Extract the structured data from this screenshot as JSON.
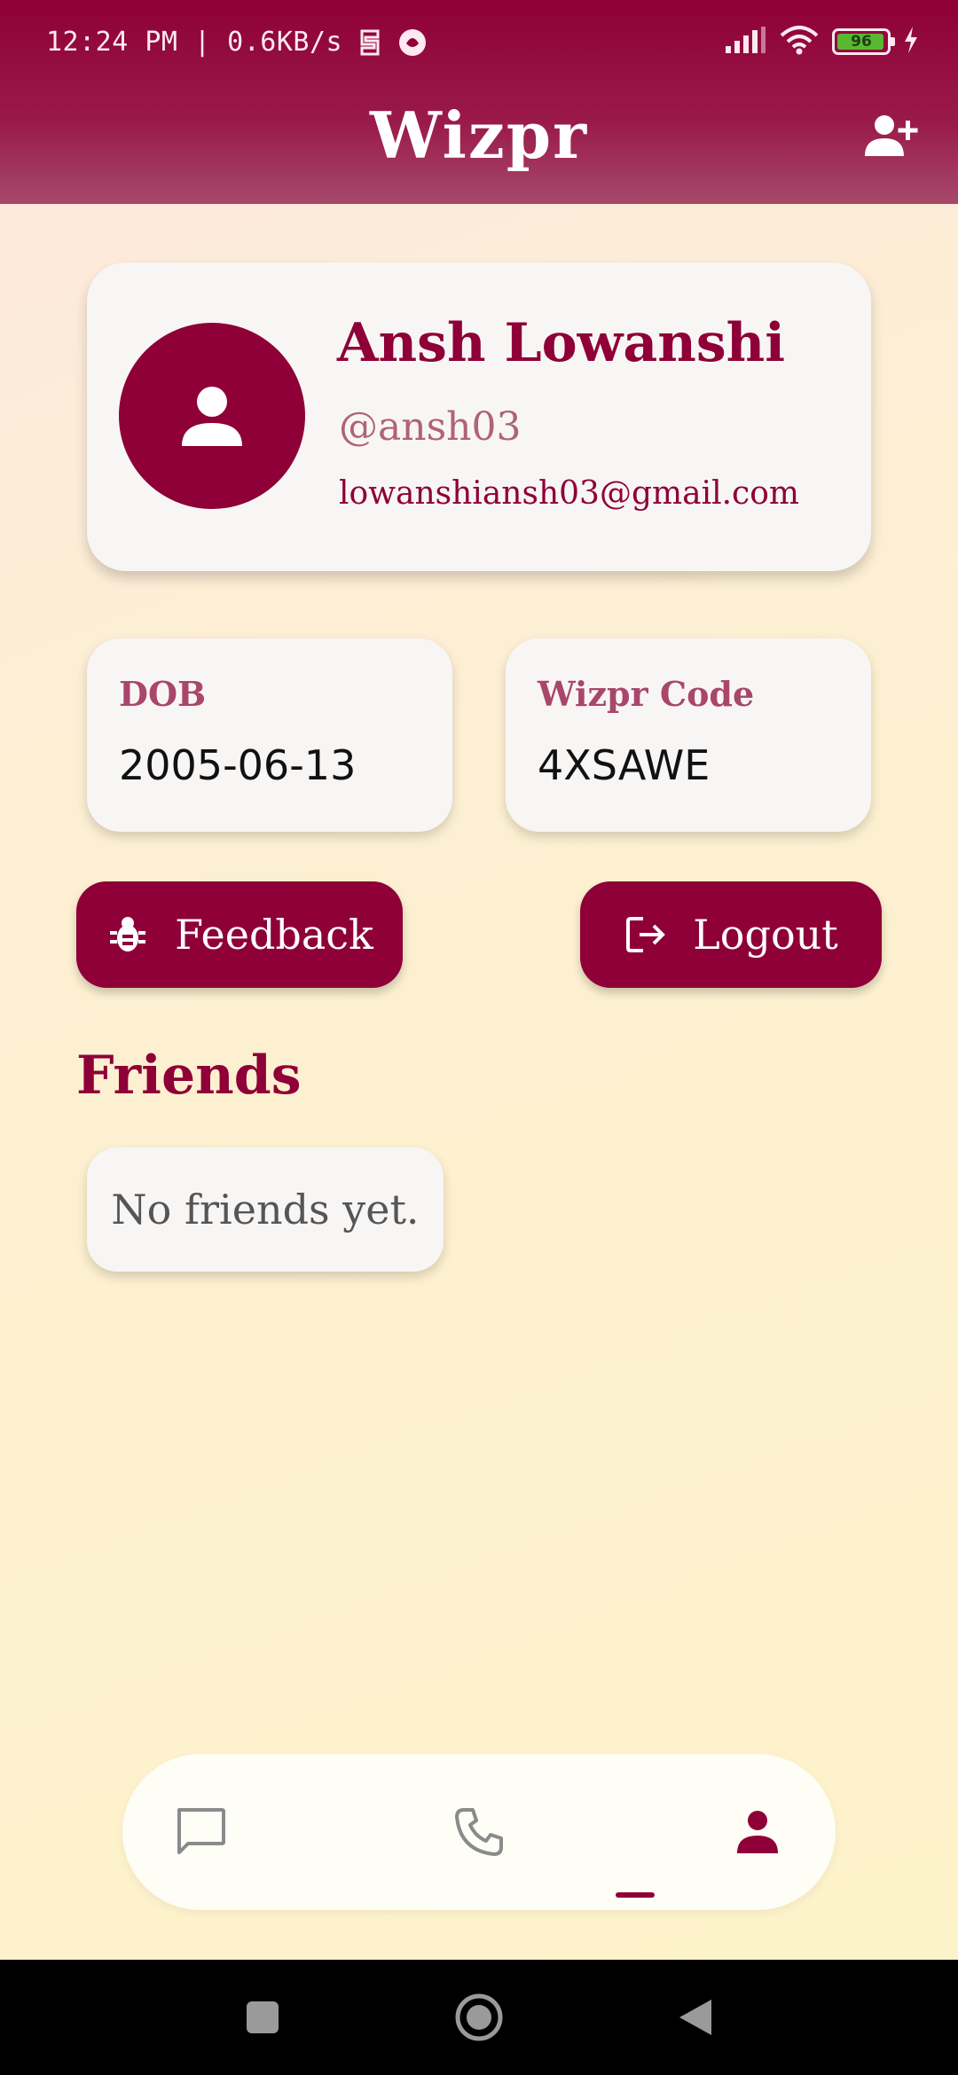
{
  "status_bar": {
    "time_and_speed": "12:24 PM | 0.6KB/s",
    "battery_percent": "96",
    "battery_level": 0.96
  },
  "header": {
    "title": "Wizpr",
    "add_friend_icon": "person-add-icon"
  },
  "profile": {
    "name": "Ansh Lowanshi",
    "handle": "@ansh03",
    "email": "lowanshiansh03@gmail.com",
    "avatar_icon": "person-icon"
  },
  "info": {
    "dob_label": "DOB",
    "dob_value": "2005-06-13",
    "code_label": "Wizpr Code",
    "code_value": "4XSAWE"
  },
  "actions": {
    "feedback_label": "Feedback",
    "feedback_icon": "bug-icon",
    "logout_label": "Logout",
    "logout_icon": "logout-icon"
  },
  "friends": {
    "title": "Friends",
    "empty_text": "No friends yet."
  },
  "bottom_nav": {
    "items": [
      {
        "icon": "chat-icon",
        "active": false
      },
      {
        "icon": "phone-icon",
        "active": false
      },
      {
        "icon": "person-icon",
        "active": true
      }
    ]
  },
  "colors": {
    "brand": "#8e0037",
    "accent_soft": "#a9466b",
    "card": "#f8f6f5",
    "inactive_icon": "#8a8a8a"
  }
}
